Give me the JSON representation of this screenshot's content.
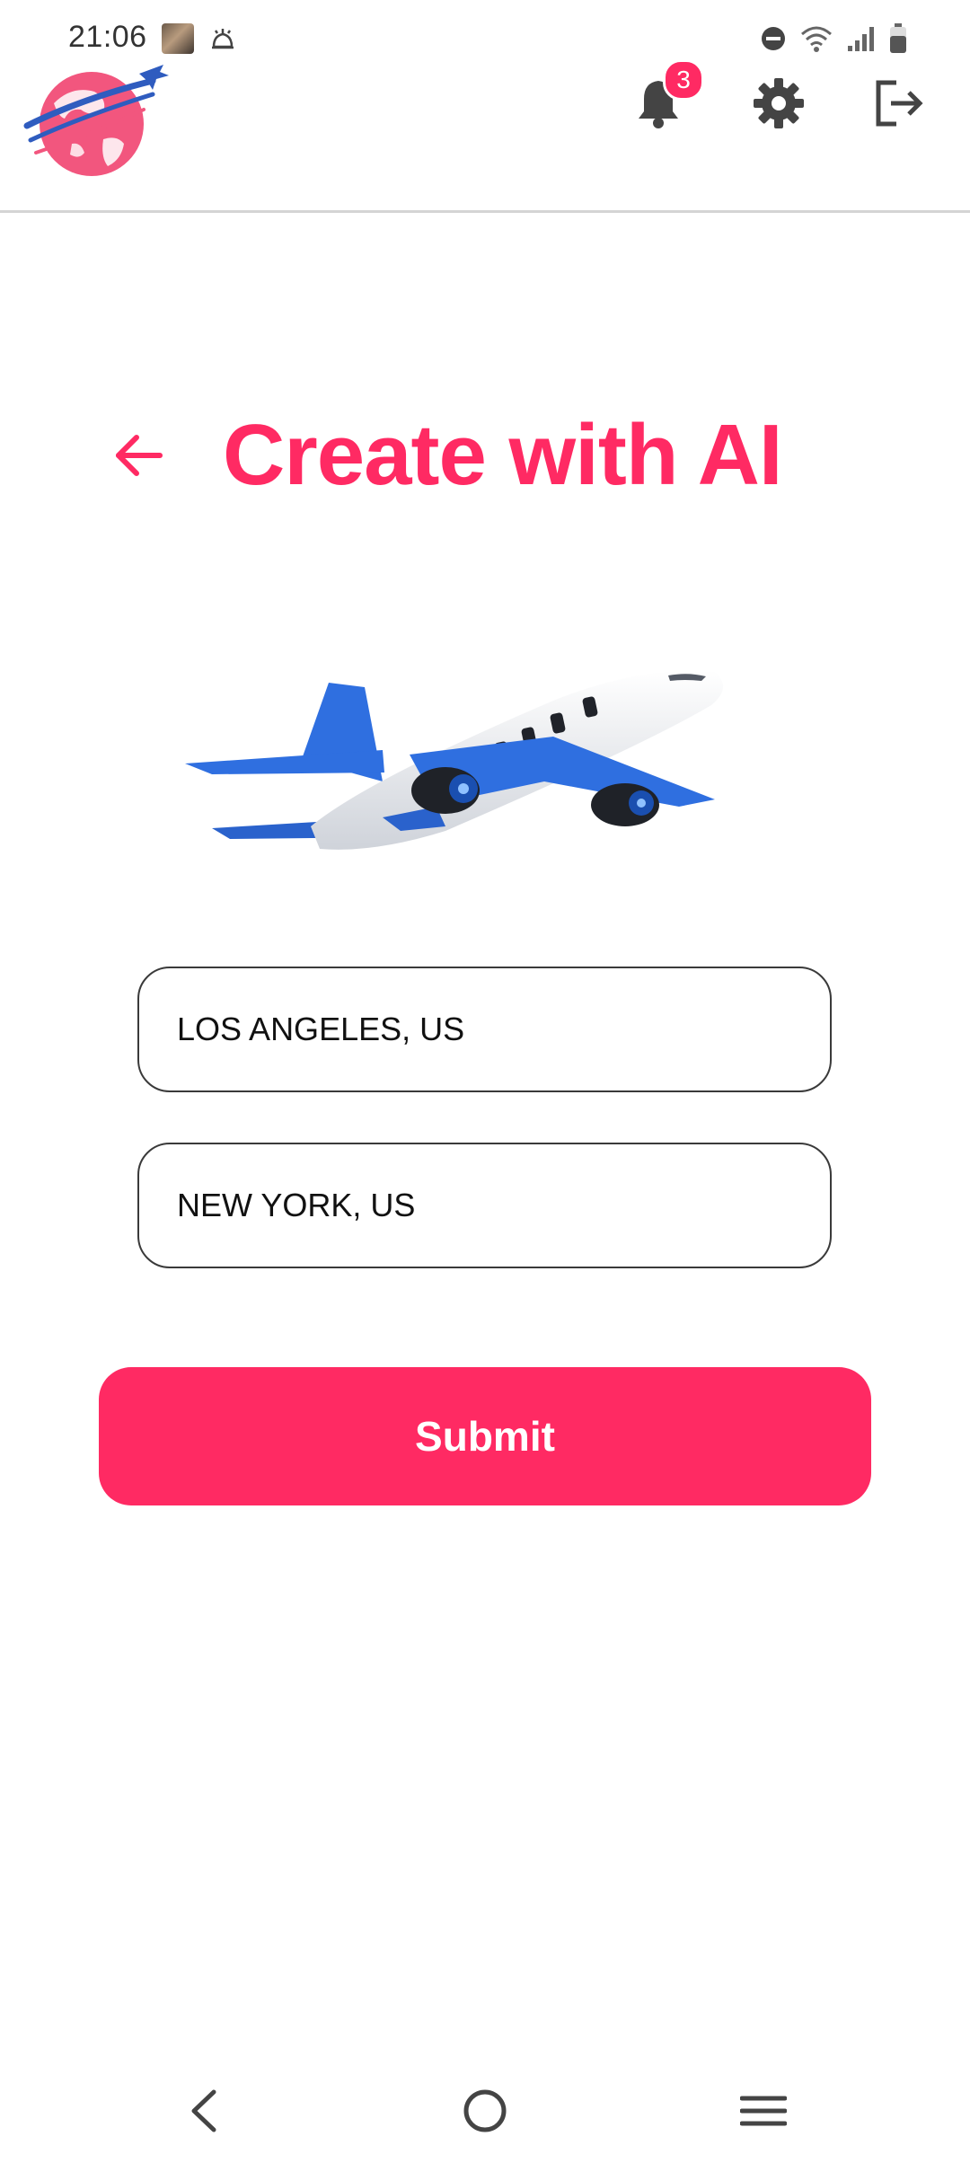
{
  "status_bar": {
    "time": "21:06",
    "icons": [
      "photo-thumbnail-icon",
      "alarm-icon",
      "do-not-disturb-icon",
      "wifi-icon",
      "signal-icon",
      "battery-icon"
    ]
  },
  "header": {
    "logo_icon": "globe-airplane-logo",
    "notification_count": "3",
    "icons": [
      "bell-icon",
      "gear-icon",
      "logout-icon"
    ]
  },
  "page": {
    "title": "Create with AI",
    "back_icon": "arrow-left-icon",
    "illustration": "airplane-illustration"
  },
  "form": {
    "origin_value": "LOS ANGELES, US",
    "destination_value": "NEW YORK, US",
    "submit_label": "Submit"
  },
  "nav_bar": {
    "icons": [
      "back-chevron-icon",
      "home-circle-icon",
      "recent-apps-icon"
    ]
  },
  "colors": {
    "accent": "#ff2a63",
    "plane_blue": "#2f6fe0",
    "text": "#111111"
  }
}
